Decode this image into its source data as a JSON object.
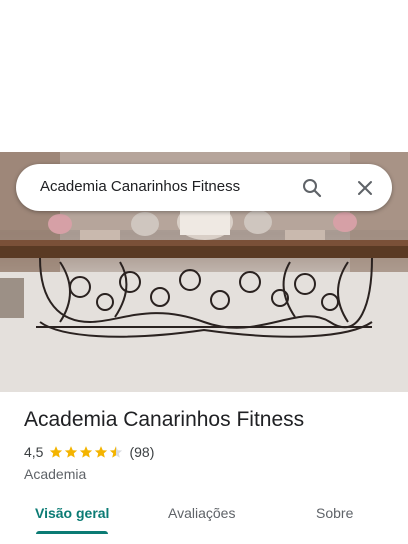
{
  "search": {
    "query": "Academia Canarinhos Fitness"
  },
  "place": {
    "name": "Academia Canarinhos Fitness",
    "rating": "4,5",
    "rating_value": 4.5,
    "reviews_count": "(98)",
    "category": "Academia"
  },
  "tabs": [
    {
      "label": "Visão geral",
      "active": true
    },
    {
      "label": "Avaliações",
      "active": false
    },
    {
      "label": "Sobre",
      "active": false
    }
  ],
  "colors": {
    "accent": "#0b7b74",
    "star": "#f4b400",
    "text": "#202124"
  },
  "icons": {
    "search": "search-icon",
    "close": "close-icon"
  }
}
